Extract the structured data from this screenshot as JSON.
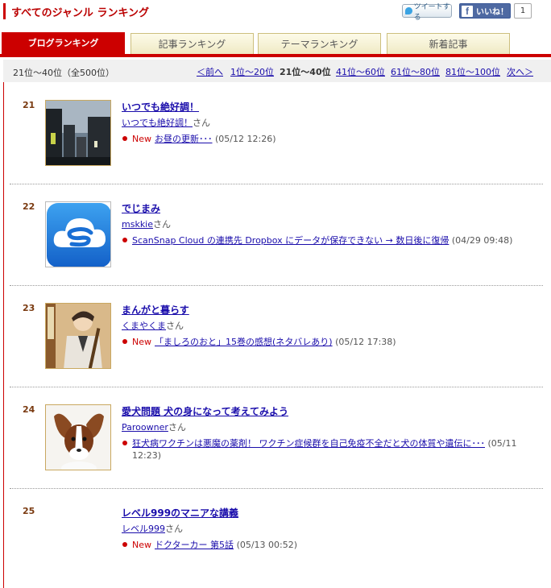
{
  "header": {
    "title": "すべてのジャンル ランキング",
    "tweet_label": "ツイートする",
    "like_label": "いいね！",
    "like_count": "1"
  },
  "tabs": [
    {
      "label": "ブログランキング",
      "active": true
    },
    {
      "label": "記事ランキング",
      "active": false
    },
    {
      "label": "テーマランキング",
      "active": false
    },
    {
      "label": "新着記事",
      "active": false
    }
  ],
  "pager": {
    "count": "21位～40位（全500位）",
    "prev": "＜前へ",
    "p1": "1位～20位",
    "current": "21位～40位",
    "p3": "41位～60位",
    "p4": "61位～80位",
    "p5": "81位～100位",
    "next": "次へ＞"
  },
  "entries": [
    {
      "rank": "21",
      "blog_title": "いつでも絶好調！",
      "author": "いつでも絶好調！",
      "author_suffix": "さん",
      "new": "New",
      "post": "お昼の更新･･･",
      "date": "(05/12 12:26)",
      "thumb": "city-photo"
    },
    {
      "rank": "22",
      "blog_title": "でじまみ",
      "author": "mskkie",
      "author_suffix": "さん",
      "new": "",
      "post": "ScanSnap Cloud の連携先 Dropbox にデータが保存できない → 数日後に復帰",
      "date": "(04/29 09:48)",
      "thumb": "scansnap-cloud-icon"
    },
    {
      "rank": "23",
      "blog_title": "まんがと暮らす",
      "author": "くまやくま",
      "author_suffix": "さん",
      "new": "New",
      "post": "「ましろのおと」15巻の感想(ネタバレあり)",
      "date": "(05/12 17:38)",
      "thumb": "manga-cover"
    },
    {
      "rank": "24",
      "blog_title": "愛犬問題 犬の身になって考えてみよう",
      "author": "Paroowner",
      "author_suffix": "さん",
      "new": "",
      "post": "狂犬病ワクチンは悪魔の薬剤！ ワクチン症候群を自己免疫不全だと犬の体質や遺伝に･･･",
      "date": "(05/11 12:23)",
      "thumb": "papillon-dog-photo"
    },
    {
      "rank": "25",
      "blog_title": "レベル999のマニアな講義",
      "author": "レベル999",
      "author_suffix": "さん",
      "new": "New",
      "post": "ドクターカー 第5話",
      "date": "(05/13 00:52)",
      "thumb": ""
    }
  ],
  "colors": {
    "accent": "#cc0000",
    "link": "#1a0dab"
  }
}
